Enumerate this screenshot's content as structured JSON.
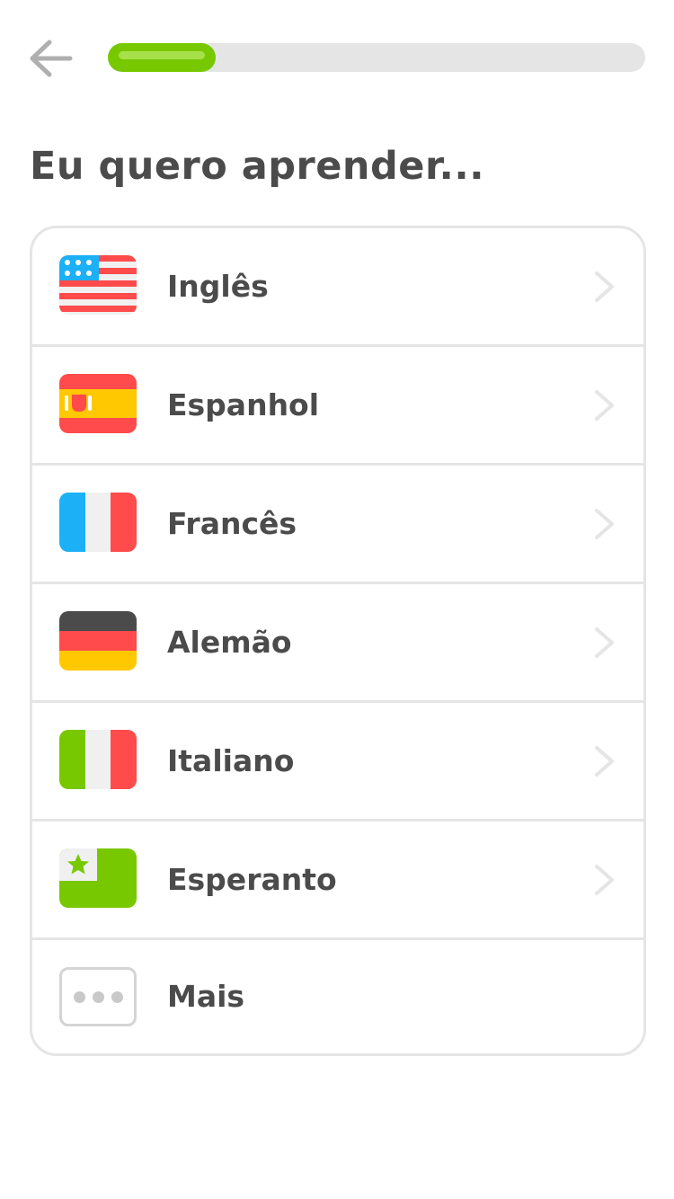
{
  "header": {
    "back_icon": "arrow-left-icon",
    "progress": 0.2
  },
  "title": "Eu quero aprender...",
  "languages": [
    {
      "label": "Inglês",
      "flag": "us-flag-icon"
    },
    {
      "label": "Espanhol",
      "flag": "spain-flag-icon"
    },
    {
      "label": "Francês",
      "flag": "france-flag-icon"
    },
    {
      "label": "Alemão",
      "flag": "germany-flag-icon"
    },
    {
      "label": "Italiano",
      "flag": "italy-flag-icon"
    },
    {
      "label": "Esperanto",
      "flag": "esperanto-flag-icon"
    },
    {
      "label": "Mais",
      "flag": "more-dots-icon"
    }
  ],
  "colors": {
    "progress_fill": "#78c800",
    "text": "#4b4b4b",
    "border": "#e5e5e5"
  }
}
